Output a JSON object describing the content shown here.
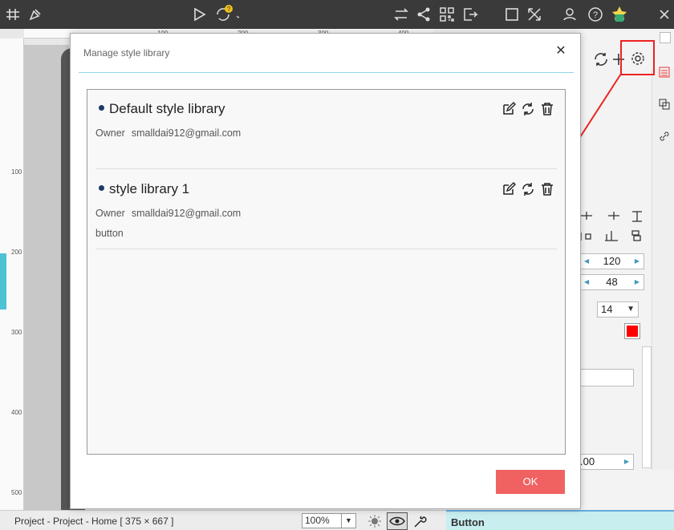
{
  "toolbar": {
    "icons": [
      "grid-icon",
      "brush-icon",
      "play-icon",
      "sync-icon",
      "transfer-icon",
      "share-icon",
      "qrcode-icon",
      "export-icon",
      "fullscreen-icon",
      "expand-icon",
      "user-icon",
      "help-icon",
      "avatar"
    ]
  },
  "ruler": {
    "top_ticks": [
      "100",
      "200",
      "300",
      "400"
    ],
    "left_ticks": [
      "100",
      "200",
      "300",
      "400",
      "500"
    ]
  },
  "dialog": {
    "title": "Manage style library",
    "close_icon": "close-icon",
    "libraries": [
      {
        "name": "Default style library",
        "owner_label": "Owner",
        "owner": "smalldai912@gmail.com",
        "extra": ""
      },
      {
        "name": "style library 1",
        "owner_label": "Owner",
        "owner": "smalldai912@gmail.com",
        "extra": "button"
      }
    ],
    "ok_label": "OK"
  },
  "panel": {
    "width_value": "120",
    "height_value": "48",
    "font_size": "14",
    "bottom_value": ".00",
    "text_color": "#ff0000"
  },
  "statusbar": {
    "project_text": "Project - Project - Home [ 375 × 667 ]",
    "zoom": "100%"
  },
  "bottom_bar": {
    "label": "Button"
  },
  "colors": {
    "ok_button": "#f06262",
    "accent_rule": "#8ed7e6",
    "highlight_box": "#e22222"
  }
}
